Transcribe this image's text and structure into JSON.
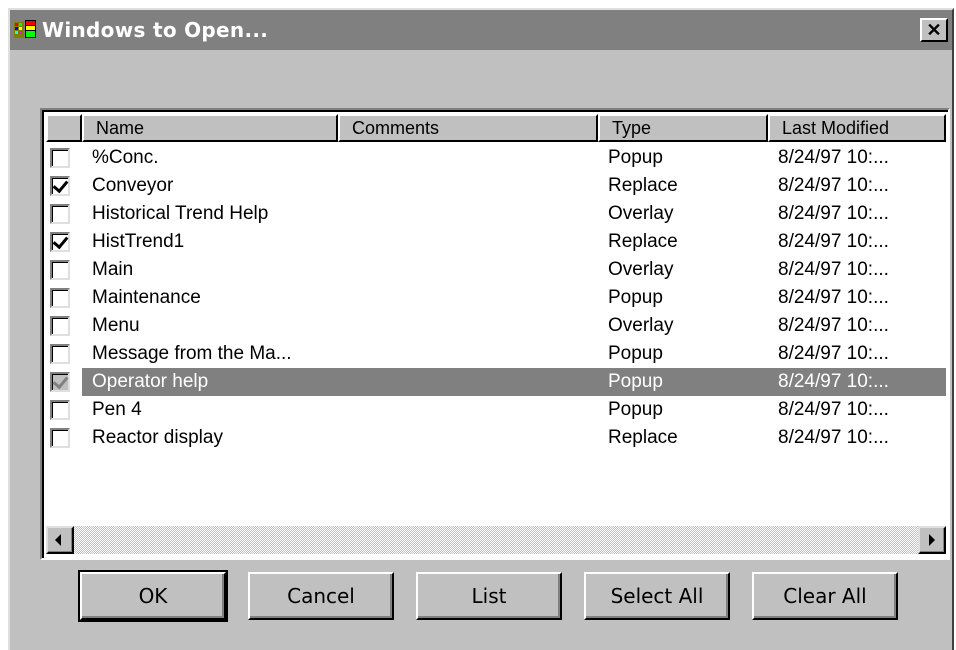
{
  "window": {
    "title": "Windows to Open..."
  },
  "icons": {
    "app": "app-window-icon",
    "close": "close-icon"
  },
  "columns": [
    "",
    "Name",
    "Comments",
    "Type",
    "Last Modified"
  ],
  "rows": [
    {
      "checked": false,
      "name": "%Conc.",
      "comments": "",
      "type": "Popup",
      "modified": "8/24/97 10:..."
    },
    {
      "checked": true,
      "name": "Conveyor",
      "comments": "",
      "type": "Replace",
      "modified": "8/24/97 10:..."
    },
    {
      "checked": false,
      "name": "Historical Trend Help",
      "comments": "",
      "type": "Overlay",
      "modified": "8/24/97 10:..."
    },
    {
      "checked": true,
      "name": "HistTrend1",
      "comments": "",
      "type": "Replace",
      "modified": "8/24/97 10:..."
    },
    {
      "checked": false,
      "name": "Main",
      "comments": "",
      "type": "Overlay",
      "modified": "8/24/97 10:..."
    },
    {
      "checked": false,
      "name": "Maintenance",
      "comments": "",
      "type": "Popup",
      "modified": "8/24/97 10:..."
    },
    {
      "checked": false,
      "name": "Menu",
      "comments": "",
      "type": "Overlay",
      "modified": "8/24/97 10:..."
    },
    {
      "checked": false,
      "name": "Message from the Ma...",
      "comments": "",
      "type": "Popup",
      "modified": "8/24/97 10:..."
    },
    {
      "checked": true,
      "selected": true,
      "name": "Operator help",
      "comments": "",
      "type": "Popup",
      "modified": "8/24/97 10:..."
    },
    {
      "checked": false,
      "name": "Pen 4",
      "comments": "",
      "type": "Popup",
      "modified": "8/24/97 10:..."
    },
    {
      "checked": false,
      "name": "Reactor display",
      "comments": "",
      "type": "Replace",
      "modified": "8/24/97 10:..."
    }
  ],
  "buttons": {
    "ok": "OK",
    "cancel": "Cancel",
    "list": "List",
    "select_all": "Select All",
    "clear_all": "Clear All"
  },
  "colors": {
    "title_bar": "#808080",
    "selection": "#808080",
    "face": "#c0c0c0"
  }
}
